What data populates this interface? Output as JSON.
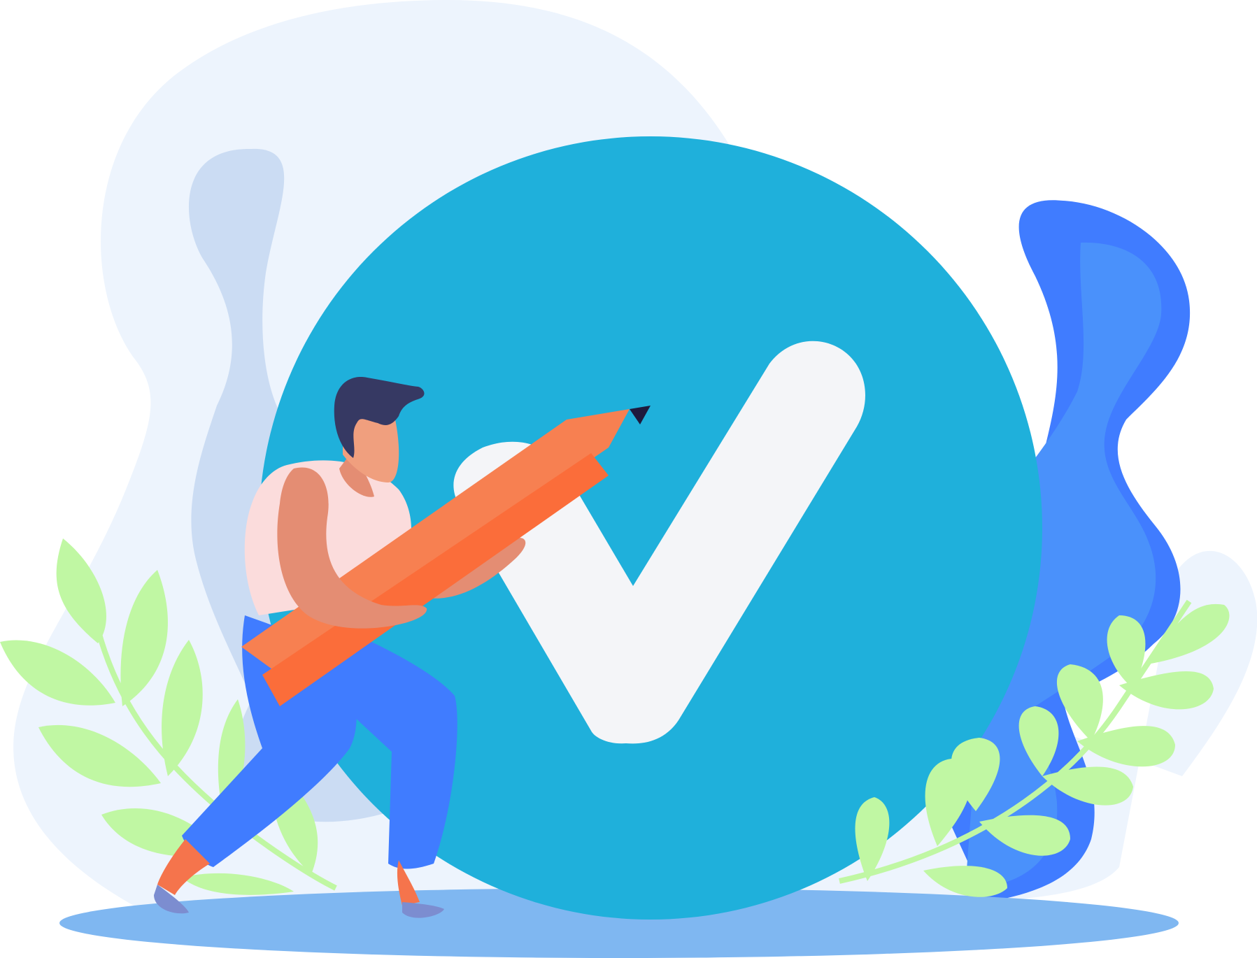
{
  "illustration": {
    "subject": "check-mark-approval",
    "colors": {
      "background": "#ffffff",
      "backdrop_blob": "#edf4fd",
      "backdrop_blob_inner": "#cbdcf3",
      "circle": "#1fb0db",
      "check": "#f4f5f8",
      "ground": "#7fb7f1",
      "leaf": "#c0f7a3",
      "right_blob_dark": "#407cff",
      "right_blob_light": "#4a91fb",
      "pencil_light": "#f78051",
      "pencil_dark": "#fb6d3a",
      "pencil_tip": "#1e1a3d",
      "hair": "#363963",
      "skin": "#f09f7e",
      "skin_shadow": "#e48d73",
      "shirt": "#fbdcdc",
      "pants": "#407cff",
      "shoe": "#7c8dd0",
      "foot": "#f5744c"
    }
  }
}
